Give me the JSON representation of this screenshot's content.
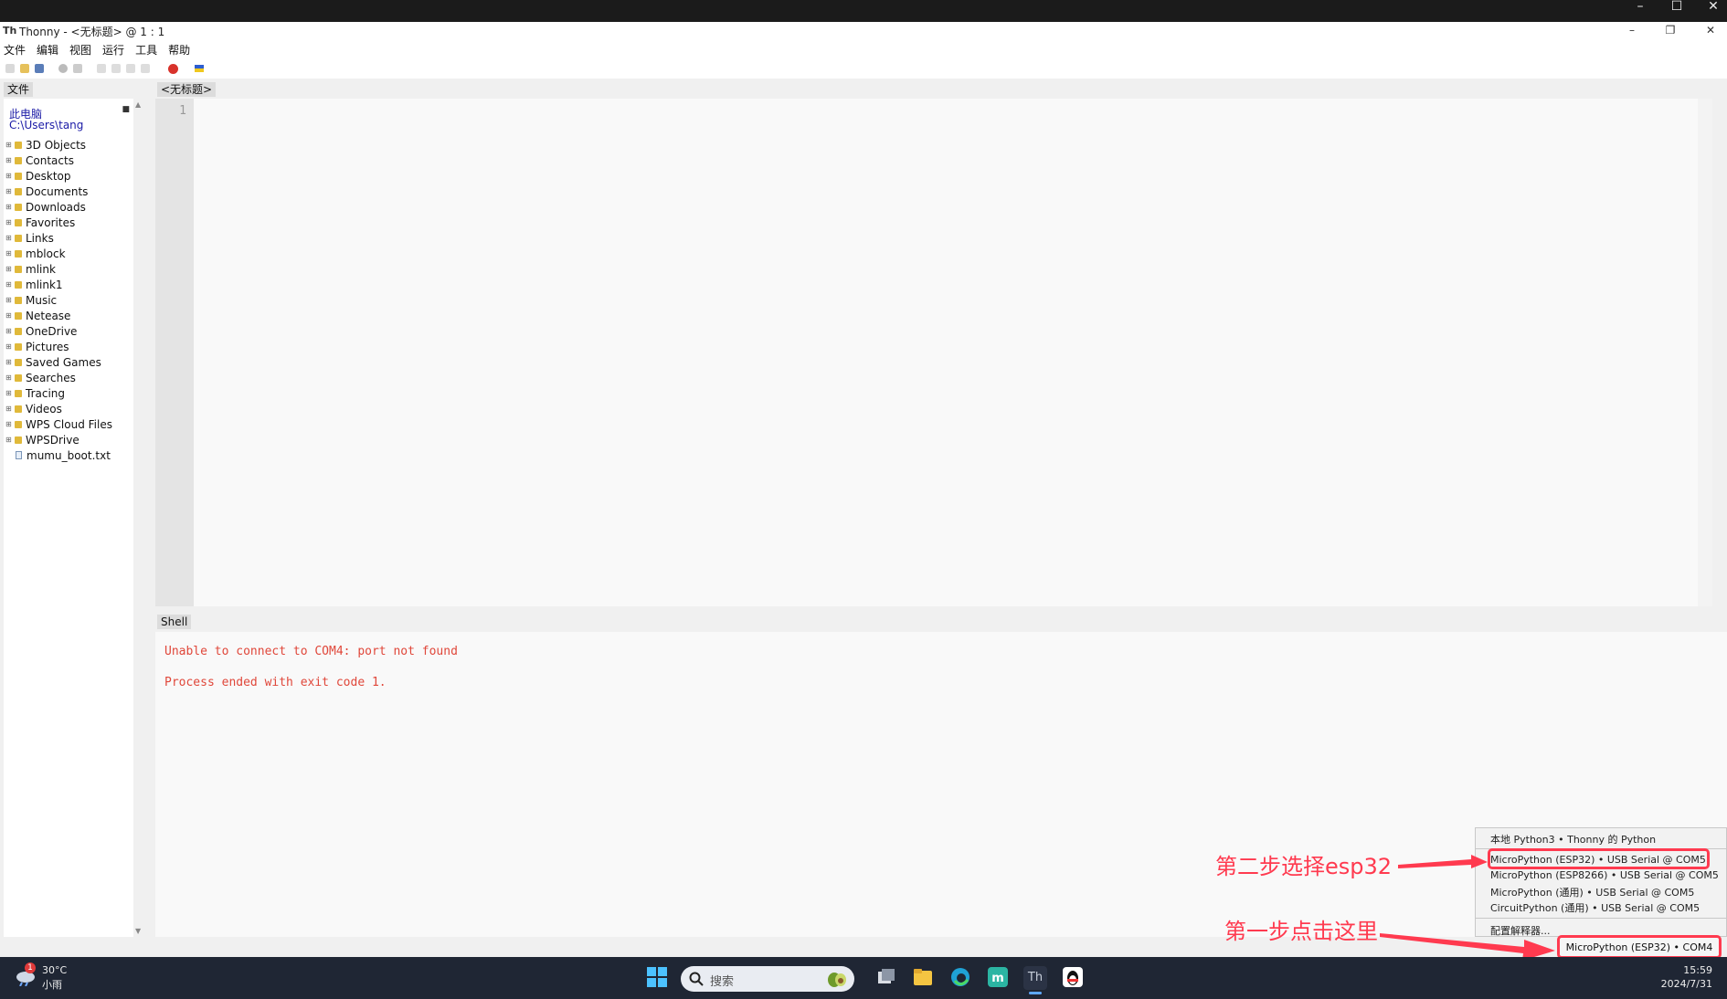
{
  "window": {
    "app_name": "Thonny",
    "title": "Thonny  -  <无标题>  @  1 : 1"
  },
  "menu": [
    "文件",
    "编辑",
    "视图",
    "运行",
    "工具",
    "帮助"
  ],
  "files": {
    "tab_label": "文件",
    "root_link": "此电脑",
    "path": "C:\\Users\\tang",
    "folders": [
      "3D Objects",
      "Contacts",
      "Desktop",
      "Documents",
      "Downloads",
      "Favorites",
      "Links",
      "mblock",
      "mlink",
      "mlink1",
      "Music",
      "Netease",
      "OneDrive",
      "Pictures",
      "Saved Games",
      "Searches",
      "Tracing",
      "Videos",
      "WPS Cloud Files",
      "WPSDrive"
    ],
    "file": "mumu_boot.txt"
  },
  "editor": {
    "tab_label": "<无标题>",
    "line_number": "1"
  },
  "shell": {
    "tab_label": "Shell",
    "lines": [
      "Unable to connect to COM4: port not found",
      "Process ended with exit code 1."
    ],
    "text_color": "#e0473a"
  },
  "interpreter_menu": {
    "options": [
      "本地 Python3  •  Thonny 的 Python",
      "MicroPython (ESP32)  •  USB Serial @ COM5",
      "MicroPython (ESP8266)  •  USB Serial @ COM5",
      "MicroPython (通用)  •  USB Serial @ COM5",
      "CircuitPython (通用)  •  USB Serial @ COM5"
    ],
    "configure": "配置解释器...",
    "current": "MicroPython (ESP32)  •  COM4"
  },
  "annotations": {
    "step2": "第二步选择esp32",
    "step1": "第一步点击这里",
    "color": "#ff3a4f"
  },
  "taskbar": {
    "notification_count": "1",
    "temperature": "30°C",
    "condition": "小雨",
    "search_placeholder": "搜索",
    "time": "15:59",
    "date": "2024/7/31"
  }
}
